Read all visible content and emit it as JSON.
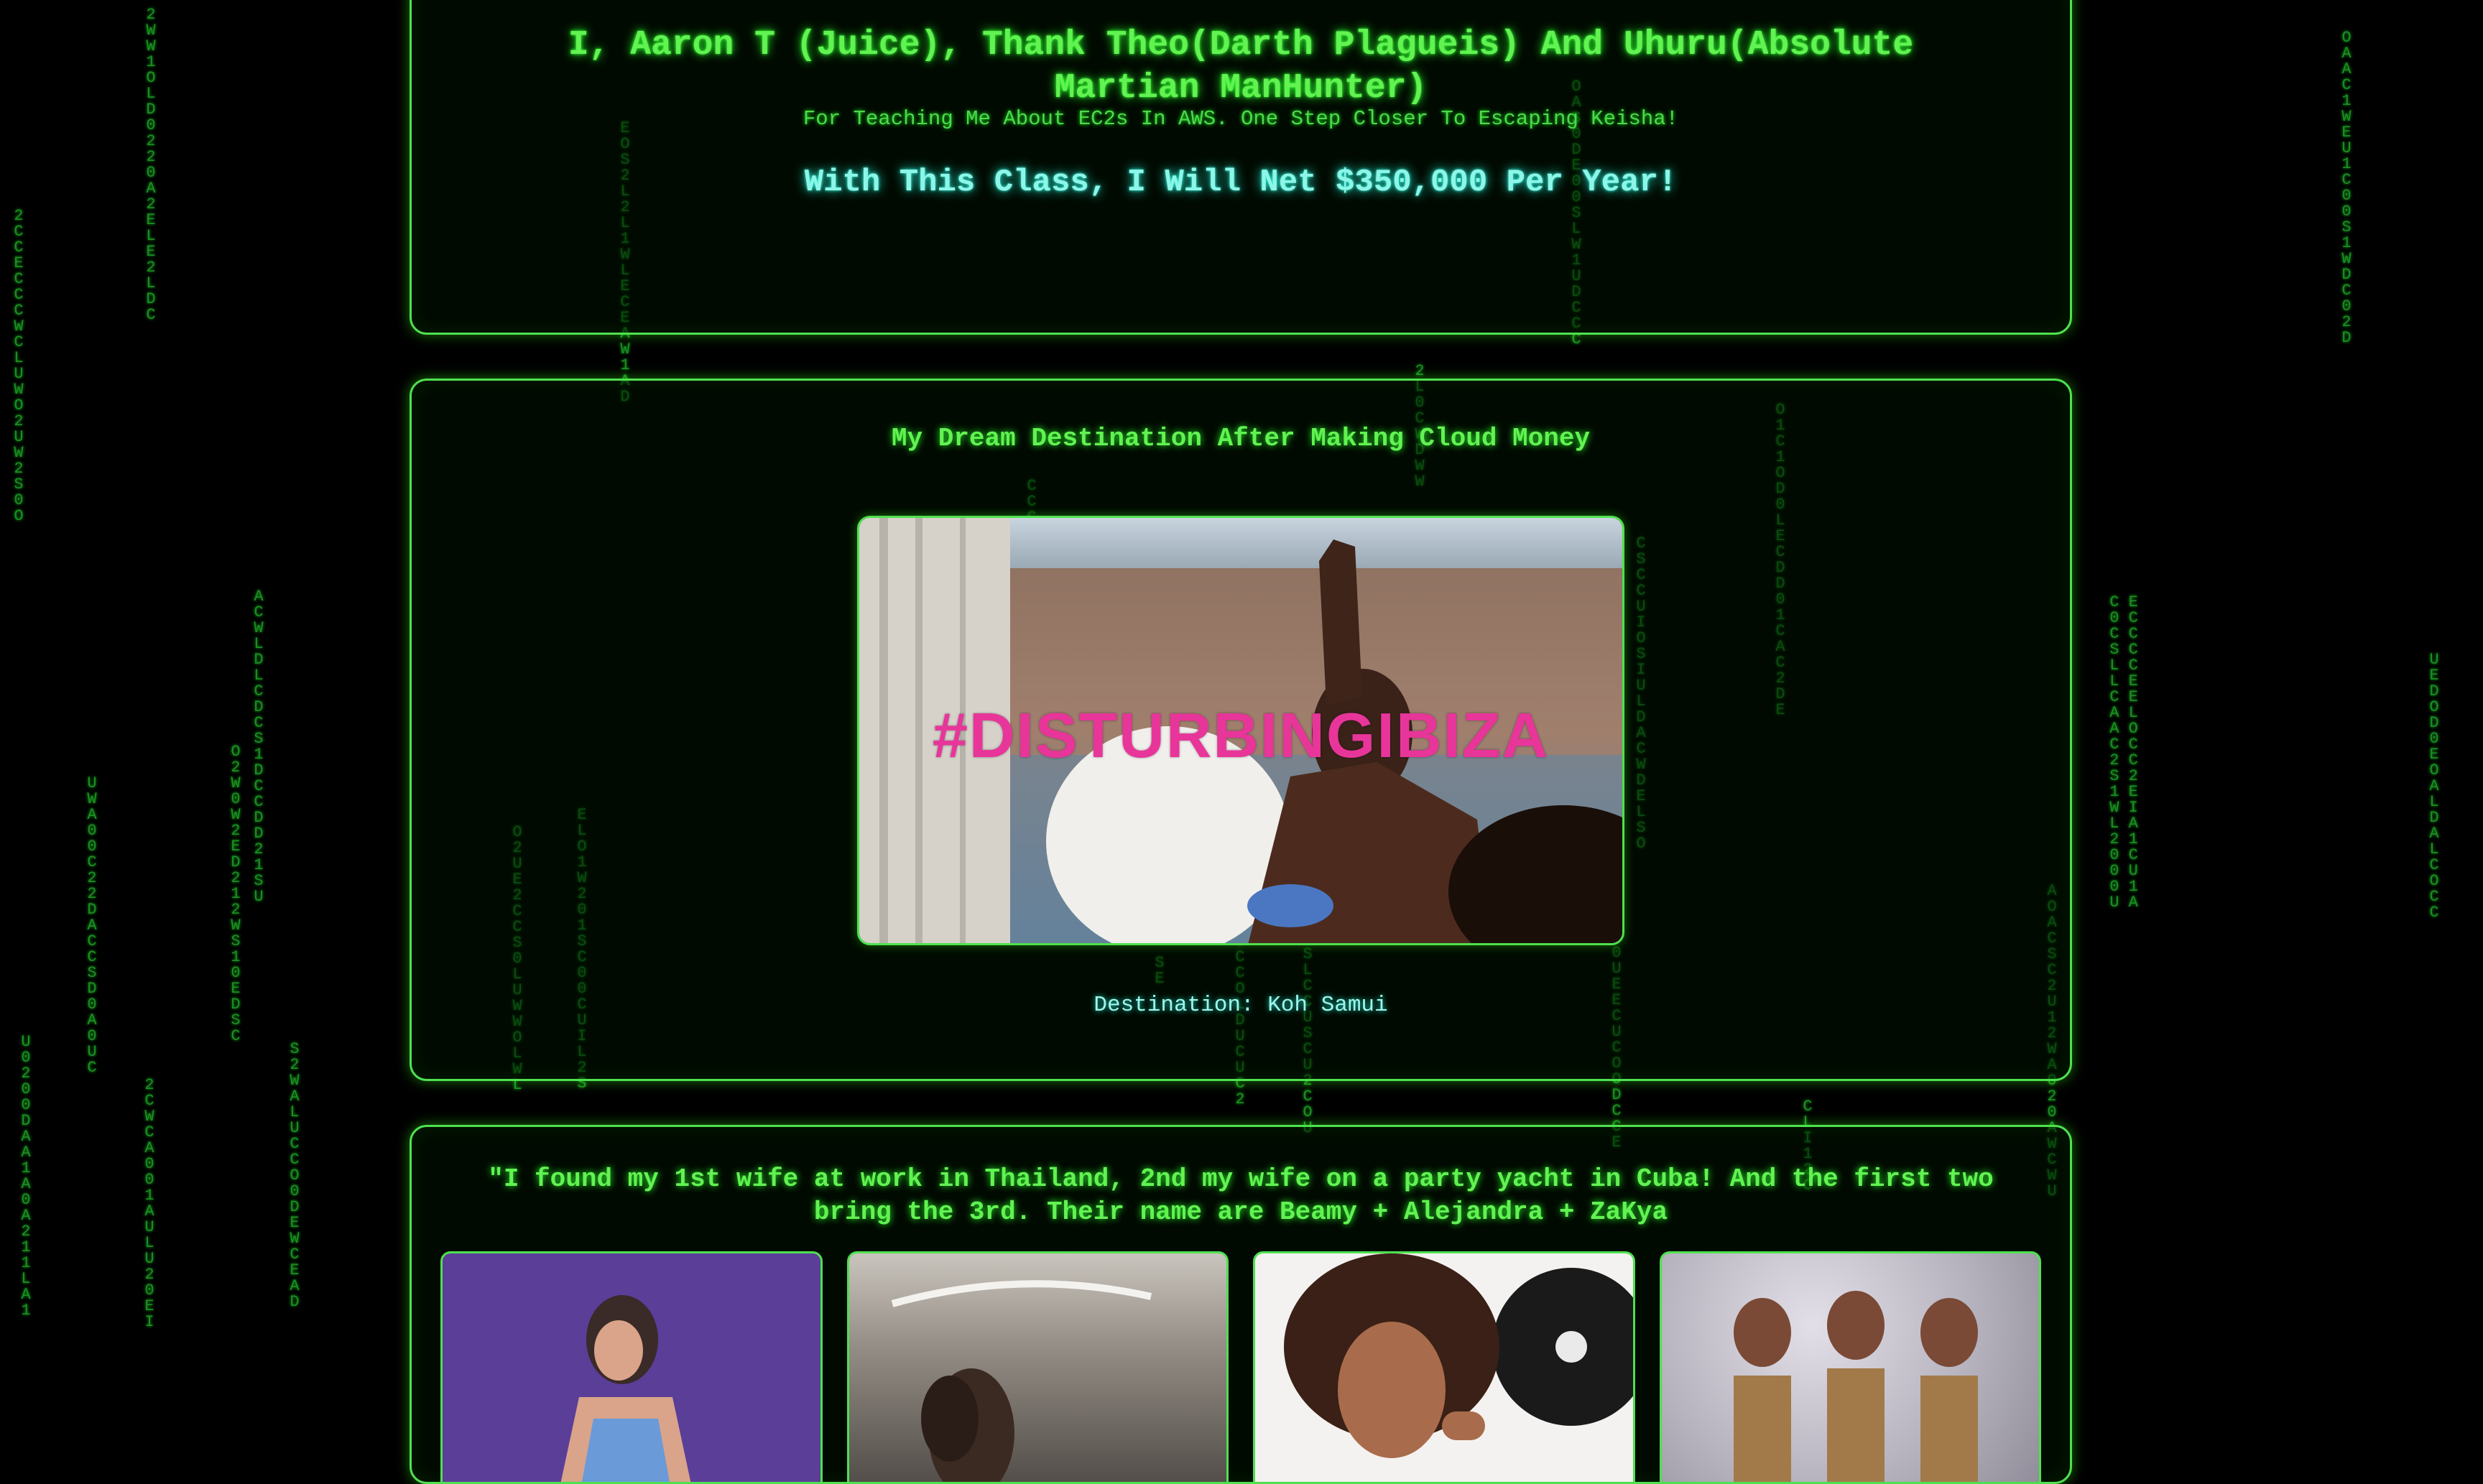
{
  "header": {
    "title": "I, Aaron T (Juice), Thank Theo(Darth Plagueis) And Uhuru(Absolute Martian ManHunter)",
    "subtitle": "For Teaching Me About EC2s In AWS. One Step Closer To Escaping Keisha!",
    "claim": "With This Class, I Will Net $350,000 Per Year!"
  },
  "destination": {
    "title": "My Dream Destination After Making Cloud Money",
    "image_overlay_text": "#DISTURBINGIBIZA",
    "caption": "Destination: Koh Samui"
  },
  "wives": {
    "quote": "\"I found my 1st wife at work in Thailand, 2nd my wife on a party yacht in Cuba! And the first two bring the 3rd. Their name are Beamy + Alejandra + ZaKya"
  },
  "colors": {
    "background": "#000000",
    "accent_green": "#4fe04f",
    "heading_green": "#62f252",
    "cyan_text": "#8ef6e8",
    "hashtag_pink": "#e8359a",
    "rain_green": "#22a82a"
  },
  "matrix_rain": [
    "2CCECCCWCLUWO2UW2S0O",
    "2WW1OLD0220A2ELE2LDC",
    "UWA00C22DACCSD0A0UC",
    "U0200DAA1A0A211LA1",
    "2CWCA001AULU20EI",
    "O2W0W2ED212WS10EDSC",
    "ACWLDLCDCS1DCCDD21SU",
    "S2WALUCCO0DEWCEAD",
    "O2UE2CCS0LUWWOLWL",
    "ELO1W201SC00CUIL2S",
    "EOS2L2L1WLECEAW1AD",
    "CCC",
    "SE",
    "CCCOLDUCUC2",
    "USLCCUSCU2COU",
    "2L0CWDWW",
    "OAS0DE00SLW1UDCCC",
    "CSCCUIOSIULDACWDELSO",
    "0UEECUCOODCCE",
    "O1C1OD0LECDD01CAC2DE",
    "CLI12C",
    "AOACSC2U12WA020AWCWU",
    "CE0CCCSCLCLECEALAOCC2CS21EWILA210C0U01UA",
    "OAAC1WEU1C00S1WDC02D",
    "UEDOD0EOALDALCOCC"
  ]
}
